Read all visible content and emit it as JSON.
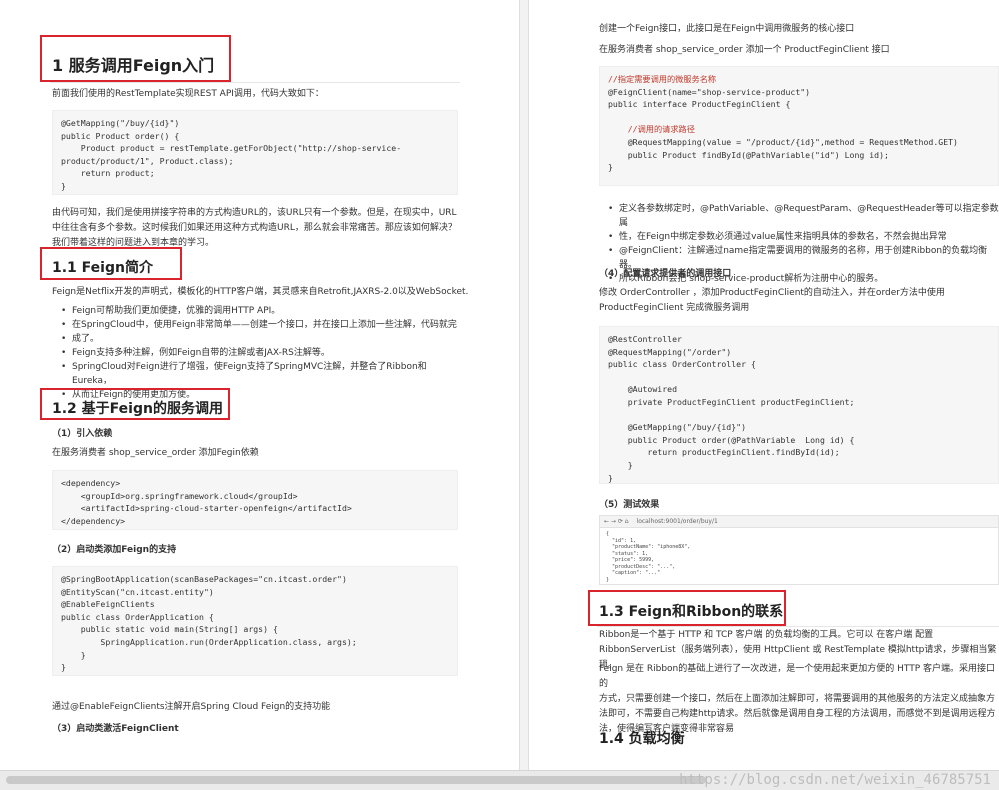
{
  "left": {
    "h1": "1 服务调用Feign入门",
    "intro": "前面我们使用的RestTemplate实现REST API调用，代码大致如下：",
    "code1": [
      "@GetMapping(\"/buy/{id}\")",
      "public Product order() {",
      "    Product product = restTemplate.getForObject(\"http://shop-service-",
      "product/product/1\", Product.class);",
      "    return product;",
      "}"
    ],
    "para2": [
      "由代码可知，我们是使用拼接字符串的方式构造URL的，该URL只有一个参数。但是，在现实中，URL",
      "中往往含有多个参数。这时候我们如果还用这种方式构造URL，那么就会非常痛苦。那应该如何解决？",
      "我们带着这样的问题进入到本章的学习。"
    ],
    "h2_1": "1.1 Feign简介",
    "para3": "Feign是Netflix开发的声明式，模板化的HTTP客户端，其灵感来自Retrofit,JAXRS-2.0以及WebSocket.",
    "bullets": [
      "Feign可帮助我们更加便捷，优雅的调用HTTP API。",
      "在SpringCloud中，使用Feign非常简单——创建一个接口，并在接口上添加一些注解，代码就完",
      "成了。",
      "Feign支持多种注解，例如Feign自带的注解或者JAX-RS注解等。",
      "SpringCloud对Feign进行了增强，使Feign支持了SpringMVC注解，并整合了Ribbon和Eureka，",
      "从而让Feign的使用更加方便。"
    ],
    "h2_2": "1.2 基于Feign的服务调用",
    "h4_1": "（1）引入依赖",
    "para4": "在服务消费者 shop_service_order 添加Fegin依赖",
    "code2": [
      "<dependency>",
      "    <groupId>org.springframework.cloud</groupId>",
      "    <artifactId>spring-cloud-starter-openfeign</artifactId>",
      "</dependency>"
    ],
    "h4_2": "（2）启动类添加Feign的支持",
    "code3": [
      "@SpringBootApplication(scanBasePackages=\"cn.itcast.order\")",
      "@EntityScan(\"cn.itcast.entity\")",
      "@EnableFeignClients",
      "public class OrderApplication {",
      "    public static void main(String[] args) {",
      "        SpringApplication.run(OrderApplication.class, args);",
      "    }",
      "}"
    ],
    "para5": "通过@EnableFeignClients注解开启Spring Cloud Feign的支持功能",
    "h4_3": "（3）启动类激活FeignClient"
  },
  "right": {
    "p1": "创建一个Feign接口，此接口是在Feign中调用微服务的核心接口",
    "p2": "在服务消费者 shop_service_order 添加一个 ProductFeginClient 接口",
    "code4": [
      "//指定需要调用的微服务名称",
      "@FeignClient(name=\"shop-service-product\")",
      "public interface ProductFeginClient {",
      "",
      "    //调用的请求路径",
      "    @RequestMapping(value = \"/product/{id}\",method = RequestMethod.GET)",
      "    public Product findById(@PathVariable(\"id\") Long id);",
      "}"
    ],
    "bullets": [
      "定义各参数绑定时，@PathVariable、@RequestParam、@RequestHeader等可以指定参数属",
      "性，在Feign中绑定参数必须通过value属性来指明具体的参数名，不然会抛出异常",
      "@FeignClient：注解通过name指定需要调用的微服务的名称，用于创建Ribbon的负载均衡器。",
      "所以Ribbon会把 shop-service-product解析为注册中心的服务。"
    ],
    "h4_4": "（4）配置请求提供者的调用接口",
    "p3": "修改 OrderController ，添加ProductFeginClient的自动注入，并在order方法中使用",
    "p3b": "ProductFeginClient 完成微服务调用",
    "code5": [
      "@RestController",
      "@RequestMapping(\"/order\")",
      "public class OrderController {",
      "",
      "    @Autowired",
      "    private ProductFeginClient productFeginClient;",
      "",
      "    @GetMapping(\"/buy/{id}\")",
      "    public Product order(@PathVariable  Long id) {",
      "        return productFeginClient.findById(id);",
      "    }",
      "}"
    ],
    "h4_5": "（5）测试效果",
    "shot_url": "localhost:9001/order/buy/1",
    "shot_body": [
      "{",
      "  \"id\": 1,",
      "  \"productName\": \"iphone8X\",",
      "  \"status\": 1,",
      "  \"price\": 5999,",
      "  \"productDesc\": \"...\",",
      "  \"caption\": \"...\"",
      "}"
    ],
    "h2_3": "1.3 Feign和Ribbon的联系",
    "p4": [
      "Ribbon是一个基于 HTTP 和 TCP 客户端 的负载均衡的工具。它可以 在客户端 配置",
      "RibbonServerList（服务端列表），使用 HttpClient 或 RestTemplate 模拟http请求，步骤相当繁琐。"
    ],
    "p5": [
      "Feign 是在 Ribbon的基础上进行了一次改进，是一个使用起来更加方便的 HTTP 客户端。采用接口的",
      "方式，只需要创建一个接口，然后在上面添加注解即可，将需要调用的其他服务的方法定义成抽象方",
      "法即可，不需要自己构建http请求。然后就像是调用自身工程的方法调用，而感觉不到是调用远程方",
      "法，使得编写客户端变得非常容易"
    ],
    "h2_4": "1.4 负载均衡"
  },
  "watermark": "https://blog.csdn.net/weixin_46785751",
  "colors": {
    "highlight_box": "#d9232d",
    "code_bg": "#f6f6f6"
  }
}
